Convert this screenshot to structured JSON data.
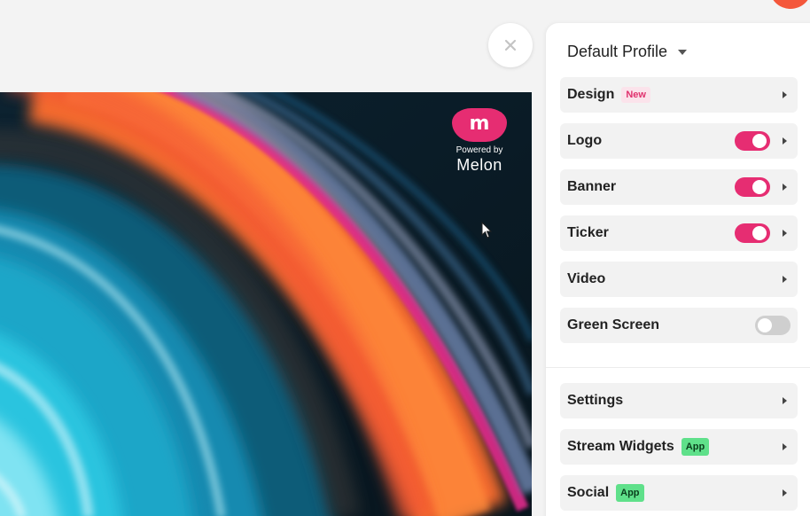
{
  "preview": {
    "logo": {
      "mark": "m",
      "powered_by": "Powered by",
      "brand": "Melon"
    }
  },
  "panel": {
    "profile_title": "Default Profile",
    "sections": [
      {
        "label": "Design",
        "badge": "New",
        "control": "chevron"
      },
      {
        "label": "Logo",
        "toggle": "on",
        "control": "chevron"
      },
      {
        "label": "Banner",
        "toggle": "on",
        "control": "chevron"
      },
      {
        "label": "Ticker",
        "toggle": "on",
        "control": "chevron"
      },
      {
        "label": "Video",
        "control": "chevron"
      },
      {
        "label": "Green Screen",
        "toggle": "off"
      }
    ],
    "extras": [
      {
        "label": "Settings",
        "control": "chevron"
      },
      {
        "label": "Stream Widgets",
        "badge": "App",
        "control": "chevron"
      },
      {
        "label": "Social",
        "badge": "App",
        "control": "chevron"
      }
    ]
  },
  "icons": {
    "close": "close-icon",
    "caret": "caret-down-icon",
    "chevron": "chevron-right-icon",
    "cursor": "mouse-pointer-icon"
  },
  "colors": {
    "accent": "#e62d72",
    "app_badge": "#5fe08a",
    "new_badge_text": "#e0306d",
    "toggle_off": "#cfcfcf",
    "corner_blob": "#f4573b"
  }
}
